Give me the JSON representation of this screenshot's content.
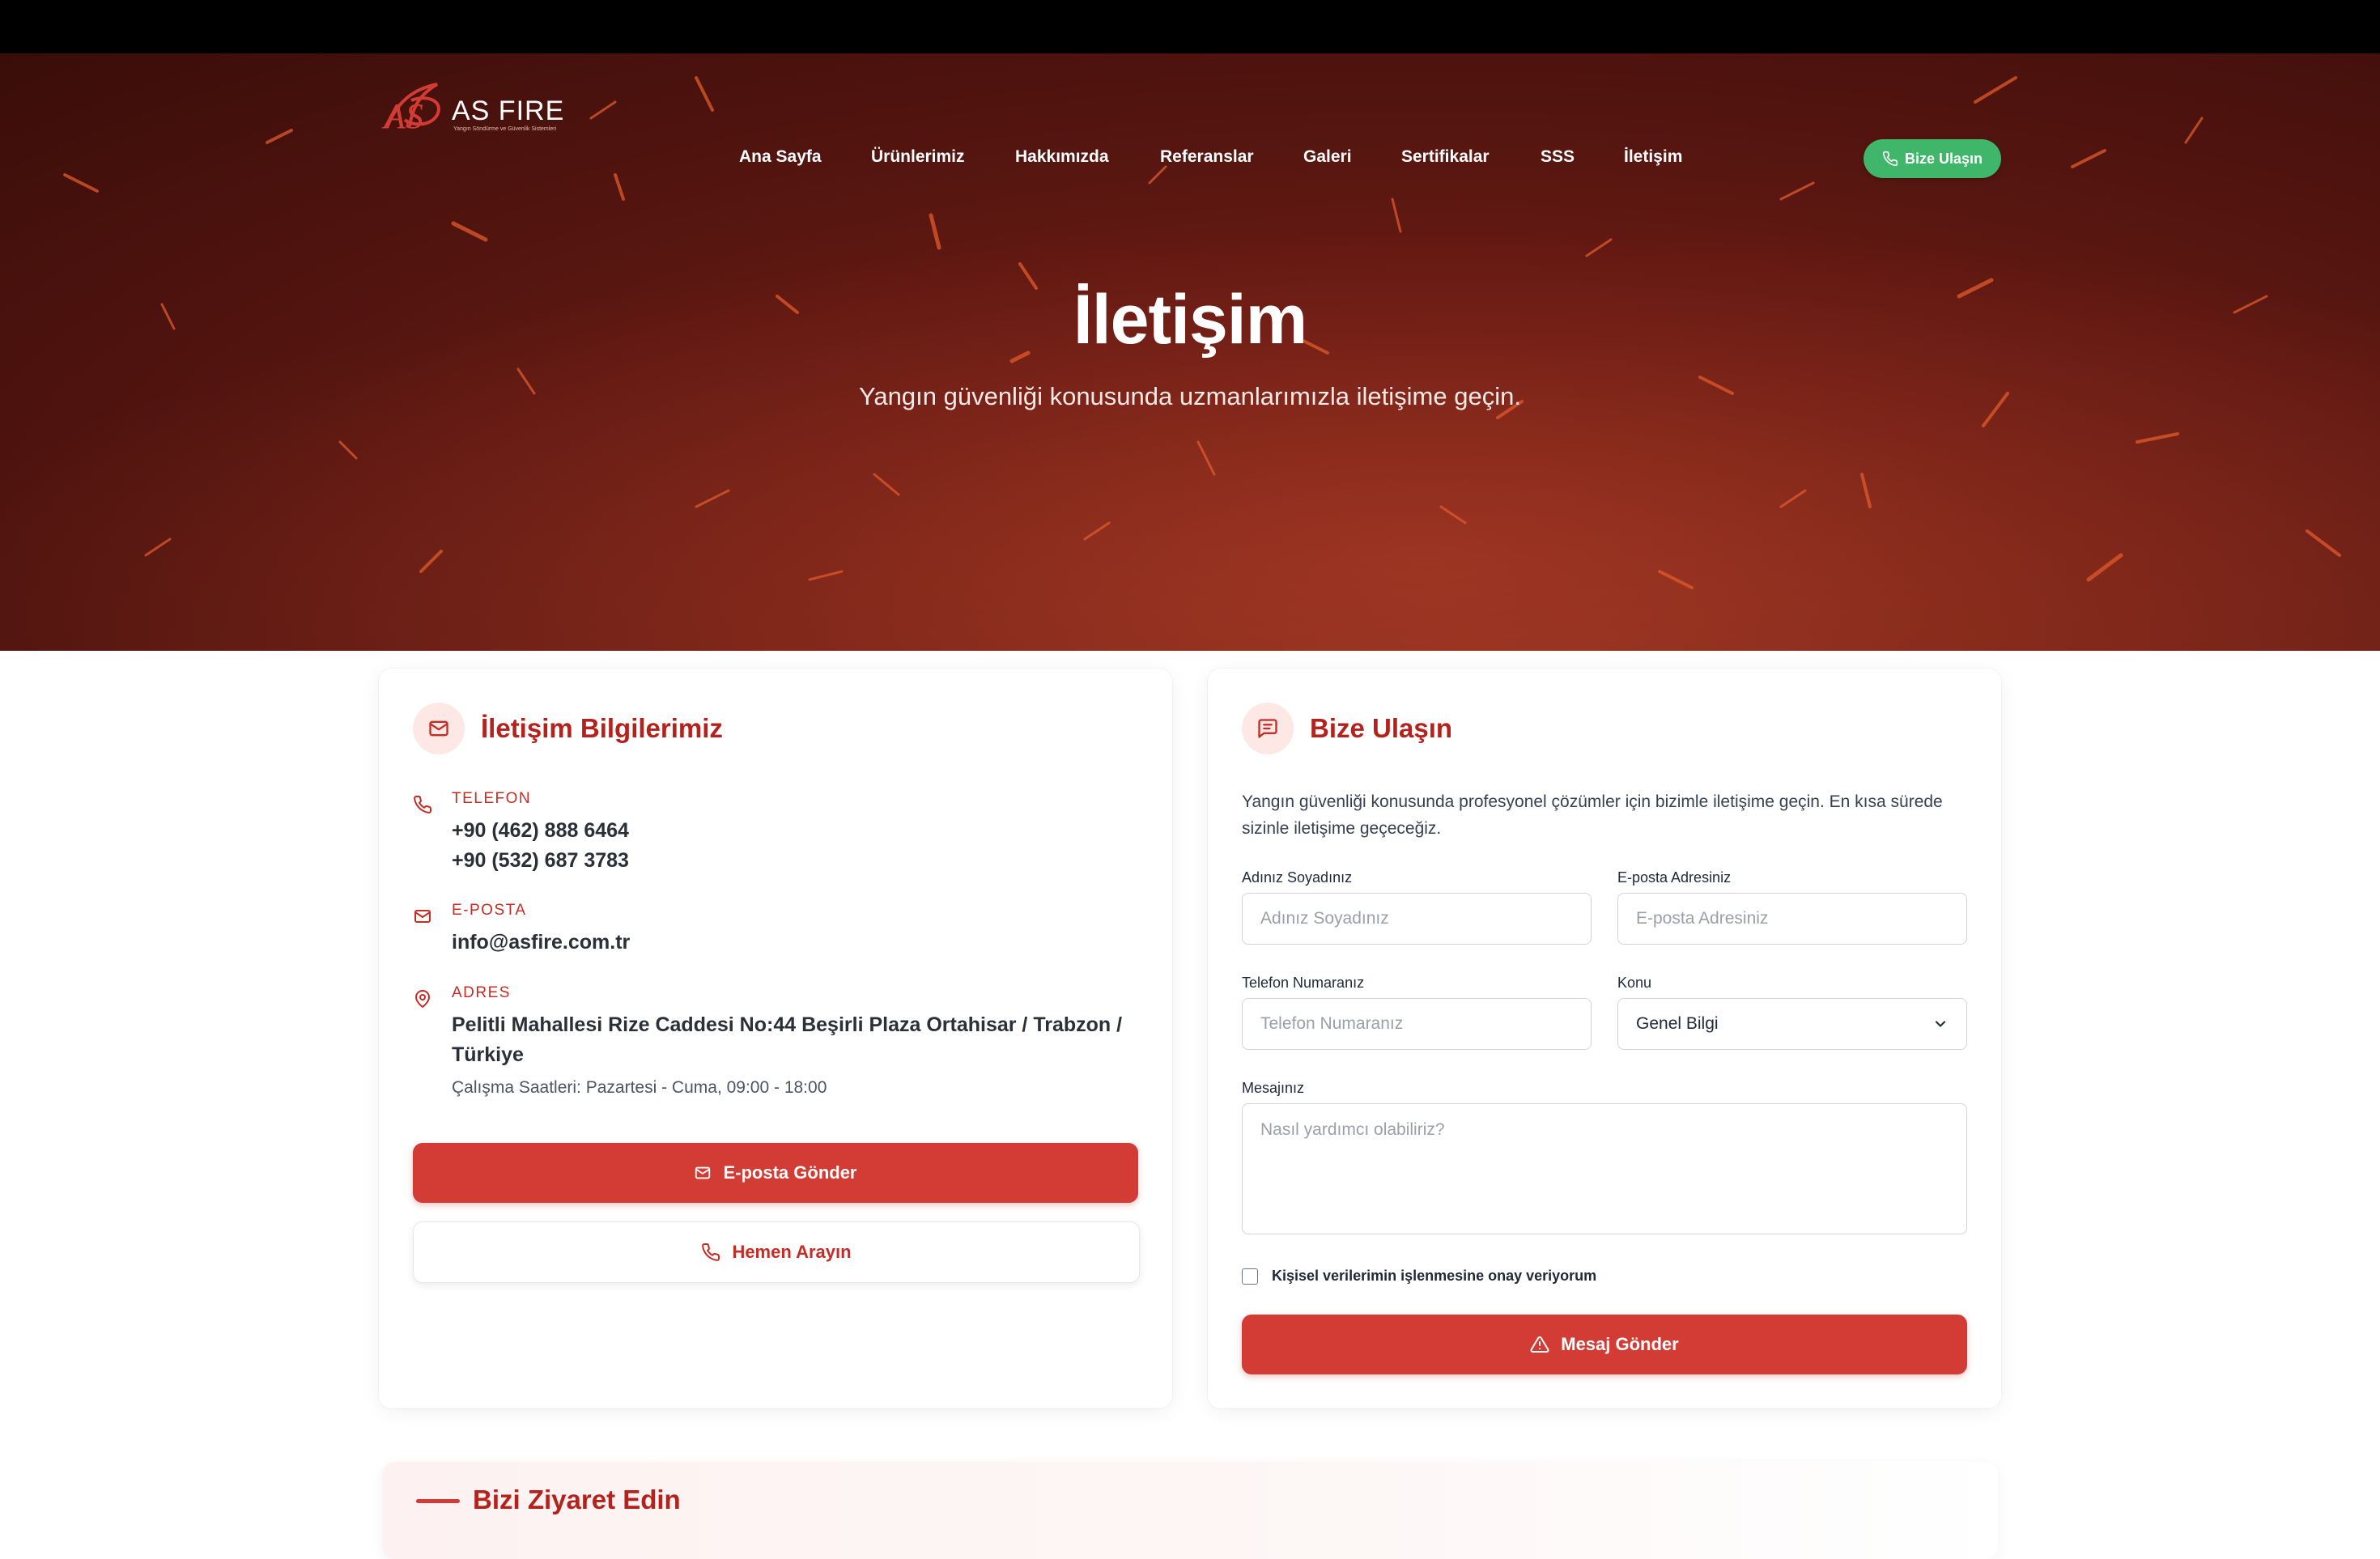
{
  "brand": {
    "name": "AS FIRE",
    "mark": "AS",
    "tagline": "Yangın Söndürme ve Güvenlik Sistemleri"
  },
  "nav": {
    "items": [
      {
        "label": "Ana Sayfa"
      },
      {
        "label": "Ürünlerimiz"
      },
      {
        "label": "Hakkımızda"
      },
      {
        "label": "Referanslar"
      },
      {
        "label": "Galeri"
      },
      {
        "label": "Sertifikalar"
      },
      {
        "label": "SSS"
      },
      {
        "label": "İletişim"
      }
    ],
    "cta_label": "Bize Ulaşın"
  },
  "hero": {
    "title": "İletişim",
    "subtitle": "Yangın güvenliği konusunda uzmanlarımızla iletişime geçin."
  },
  "contact_info": {
    "title": "İletişim Bilgilerimiz",
    "phone_label": "TELEFON",
    "phone_1": "+90 (462) 888 6464",
    "phone_2": "+90 (532) 687 3783",
    "email_label": "E-POSTA",
    "email": "info@asfire.com.tr",
    "address_label": "ADRES",
    "address_line_1": "Pelitli Mahallesi Rize Caddesi No:44 Beşirli Plaza Ortahisar / Trabzon /",
    "address_line_2": "Türkiye",
    "hours": "Çalışma Saatleri: Pazartesi - Cuma, 09:00 - 18:00",
    "email_button": "E-posta Gönder",
    "call_button": "Hemen Arayın"
  },
  "contact_form": {
    "title": "Bize Ulaşın",
    "intro": "Yangın güvenliği konusunda profesyonel çözümler için bizimle iletişime geçin. En kısa sürede sizinle iletişime geçeceğiz.",
    "name_label": "Adınız Soyadınız",
    "name_placeholder": "Adınız Soyadınız",
    "email_label": "E-posta Adresiniz",
    "email_placeholder": "E-posta Adresiniz",
    "phone_label": "Telefon Numaranız",
    "phone_placeholder": "Telefon Numaranız",
    "subject_label": "Konu",
    "subject_value": "Genel Bilgi",
    "message_label": "Mesajınız",
    "message_placeholder": "Nasıl yardımcı olabiliriz?",
    "consent_label": "Kişisel verilerimin işlenmesine onay veriyorum",
    "consent_checked": false,
    "submit_label": "Mesaj Gönder"
  },
  "visit": {
    "title": "Bizi Ziyaret Edin"
  },
  "colors": {
    "primary_red": "#d33b35",
    "heading_red": "#b5221c",
    "cta_green": "#3fb66a",
    "hero_dark": "#551510"
  }
}
